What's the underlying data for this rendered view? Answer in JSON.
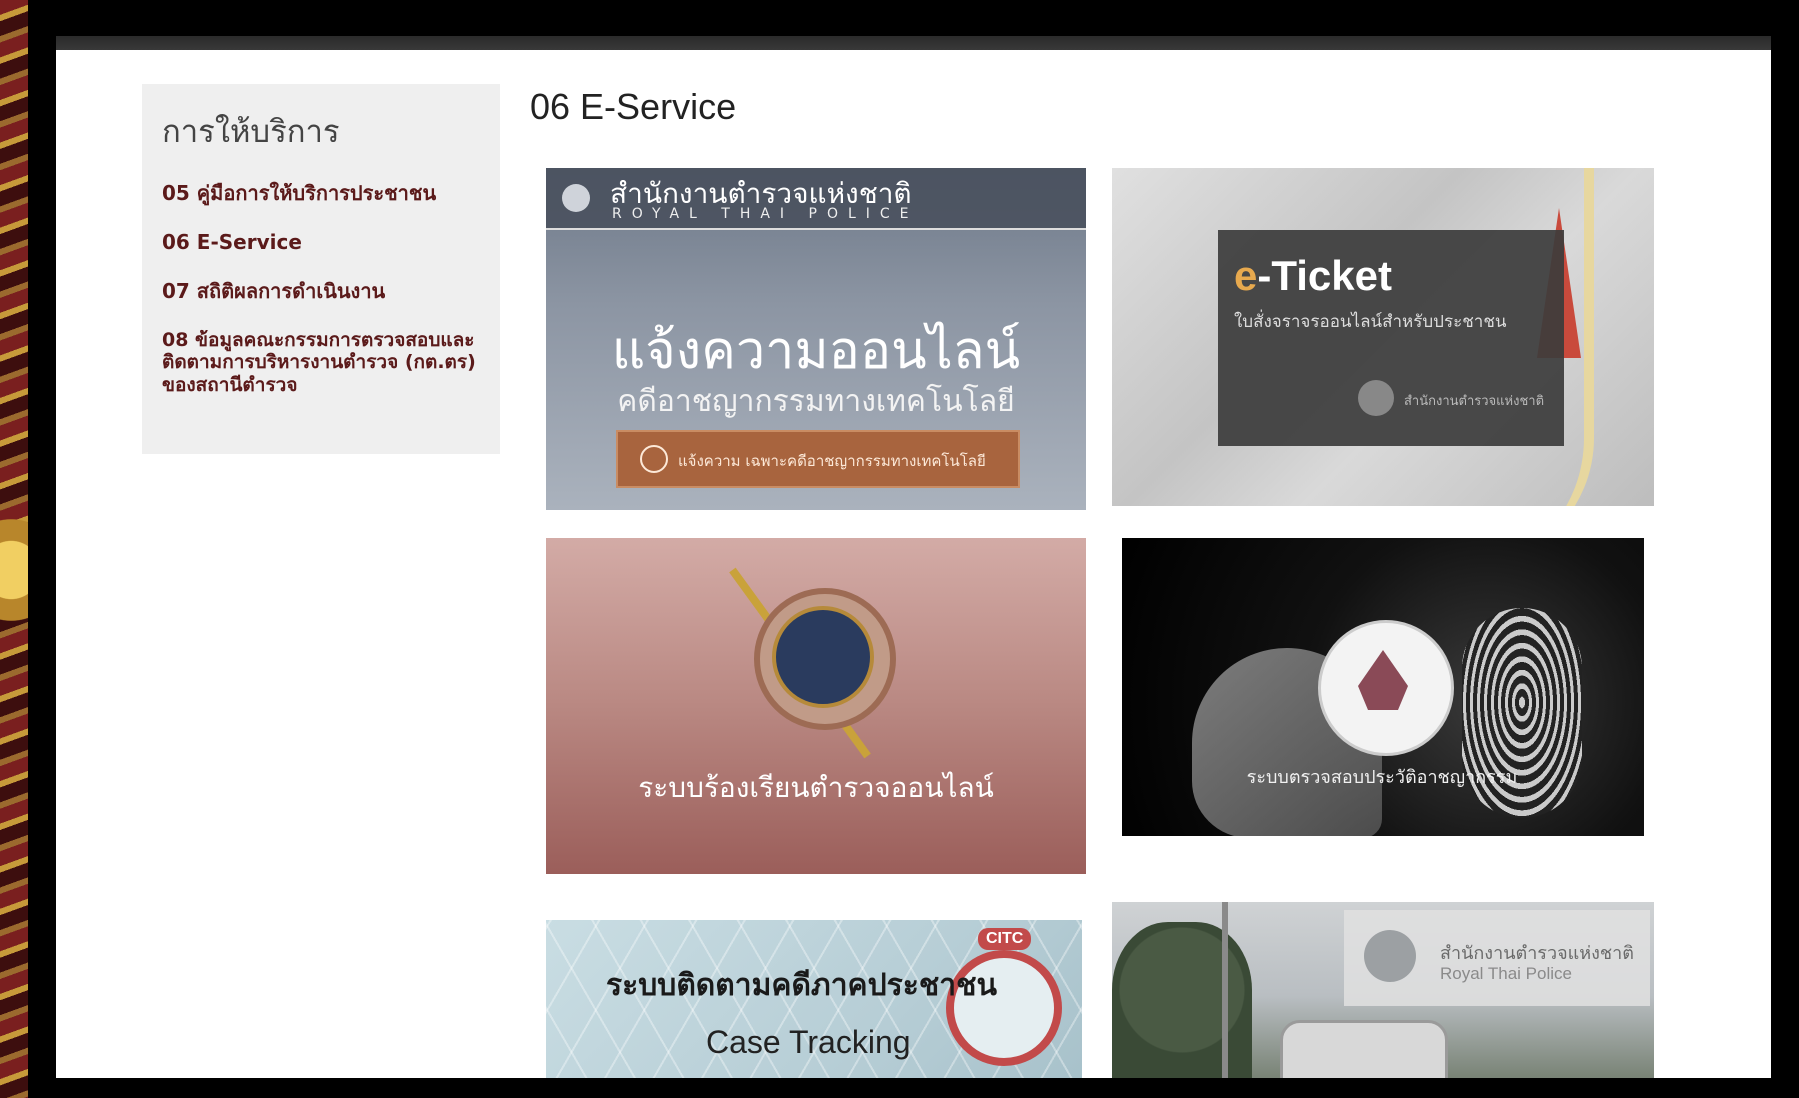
{
  "sidebar": {
    "title": "การให้บริการ",
    "items": [
      {
        "label": "05 คู่มือการให้บริการประชาชน"
      },
      {
        "label": "06 E-Service"
      },
      {
        "label": "07 สถิติผลการดำเนินงาน"
      },
      {
        "label": "08 ข้อมูลคณะกรรมการตรวจสอบและติดตามการบริหารงานตำรวจ (กต.ตร) ของสถานีตำรวจ"
      }
    ]
  },
  "main": {
    "title": "06 E-Service"
  },
  "cards": [
    {
      "org_th": "สำนักงานตำรวจแห่งชาติ",
      "org_en": "ROYAL THAI POLICE",
      "headline": "แจ้งความออนไลน์",
      "subheadline": "คดีอาชญากรรมทางเทคโนโลยี",
      "cta": "แจ้งความ เฉพาะคดีอาชญากรรมทางเทคโนโลยี"
    },
    {
      "title_prefix": "e",
      "title_rest": "-Ticket",
      "subtitle": "ใบสั่งจราจรออนไลน์สำหรับประชาชน",
      "org": "สำนักงานตำรวจแห่งชาติ"
    },
    {
      "title": "ระบบร้องเรียนตำรวจออนไลน์"
    },
    {
      "title": "ระบบตรวจสอบประวัติอาชญากรรม"
    },
    {
      "tag": "CITC",
      "title": "ระบบติดตามคดีภาคประชาชน",
      "subtitle": "Case Tracking"
    },
    {
      "org_th": "สำนักงานตำรวจแห่งชาติ",
      "org_en": "Royal Thai Police"
    }
  ]
}
